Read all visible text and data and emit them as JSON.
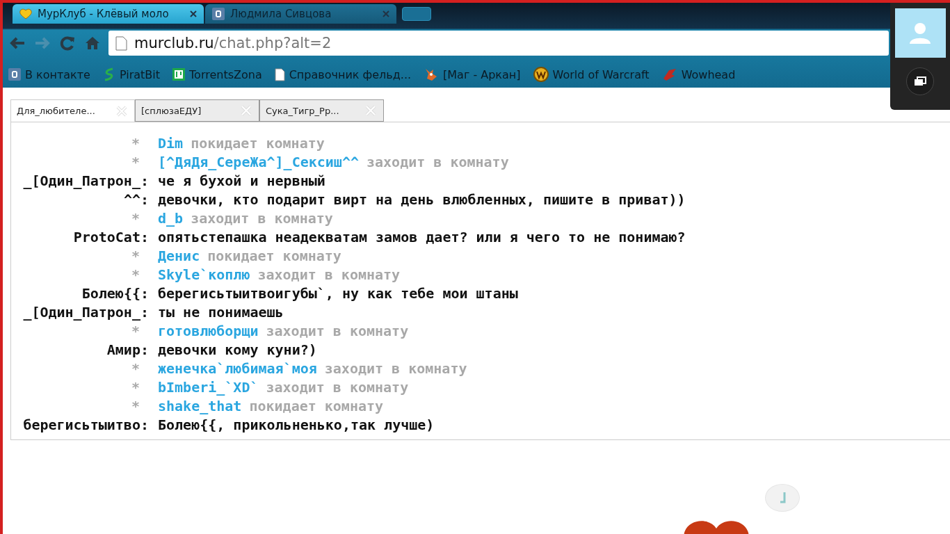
{
  "browser_tabs": [
    {
      "title": "МурКлуб - Клёвый моло",
      "selected": true
    },
    {
      "title": "Людмила Сивцова",
      "selected": false
    }
  ],
  "address_bar": {
    "domain": "murclub.ru",
    "path": "/chat.php?alt=2"
  },
  "bookmarks": [
    {
      "label": "В контакте"
    },
    {
      "label": "PiratBit"
    },
    {
      "label": "TorrentsZona"
    },
    {
      "label": "Справочник фельд..."
    },
    {
      "label": "[Маг - Аркан]"
    },
    {
      "label": "World of Warcraft"
    },
    {
      "label": "Wowhead"
    }
  ],
  "chat_tabs": [
    {
      "label": "Для_любителе...",
      "selected": true
    },
    {
      "label": "[сплюзаЕДУ]",
      "selected": false
    },
    {
      "label": "Сука_Тигр_Рр...",
      "selected": false
    }
  ],
  "messages": [
    {
      "kind": "event",
      "star": "*",
      "nick": "Dim",
      "action": "покидает комнату"
    },
    {
      "kind": "event",
      "star": "*",
      "nick": "[^ДяДя_СереЖа^]_Сексиш^^",
      "action": "заходит в комнату"
    },
    {
      "kind": "message",
      "author": "_[Один_Патрон_:",
      "text": "че я бухой и нервный"
    },
    {
      "kind": "message",
      "author": "^^:",
      "text": "девочки, кто подарит вирт на день влюбленных, пишите в приват))"
    },
    {
      "kind": "event",
      "star": "*",
      "nick": "d_b",
      "action": "заходит в комнату"
    },
    {
      "kind": "message",
      "author": "ProtoCat:",
      "text": "опятьстепашка неадекватам замов дает? или я чего то не понимаю?"
    },
    {
      "kind": "event",
      "star": "*",
      "nick": "Денис",
      "action": "покидает комнату"
    },
    {
      "kind": "event",
      "star": "*",
      "nick": "Skyle`коплю",
      "action": "заходит в комнату"
    },
    {
      "kind": "message",
      "author": "Болею{{:",
      "text": "берегисьтыитвоигубы`, ну как тебе мои штаны"
    },
    {
      "kind": "message",
      "author": "_[Один_Патрон_:",
      "text": "ты не понимаешь"
    },
    {
      "kind": "event",
      "star": "*",
      "nick": "готовлюборщи",
      "action": "заходит в комнату"
    },
    {
      "kind": "message",
      "author": "Амир:",
      "text": "девочки кому куни?)"
    },
    {
      "kind": "event",
      "star": "*",
      "nick": "женечка`любимая`моя",
      "action": "заходит в комнату"
    },
    {
      "kind": "event",
      "star": "*",
      "nick": "bImberi_`XD`",
      "action": "заходит в комнату"
    },
    {
      "kind": "event",
      "star": "*",
      "nick": "shake_that",
      "action": "покидает комнату"
    },
    {
      "kind": "message",
      "author": "берегисьтыитво:",
      "text": "Болею{{, прикольненько,так лучше)"
    }
  ]
}
